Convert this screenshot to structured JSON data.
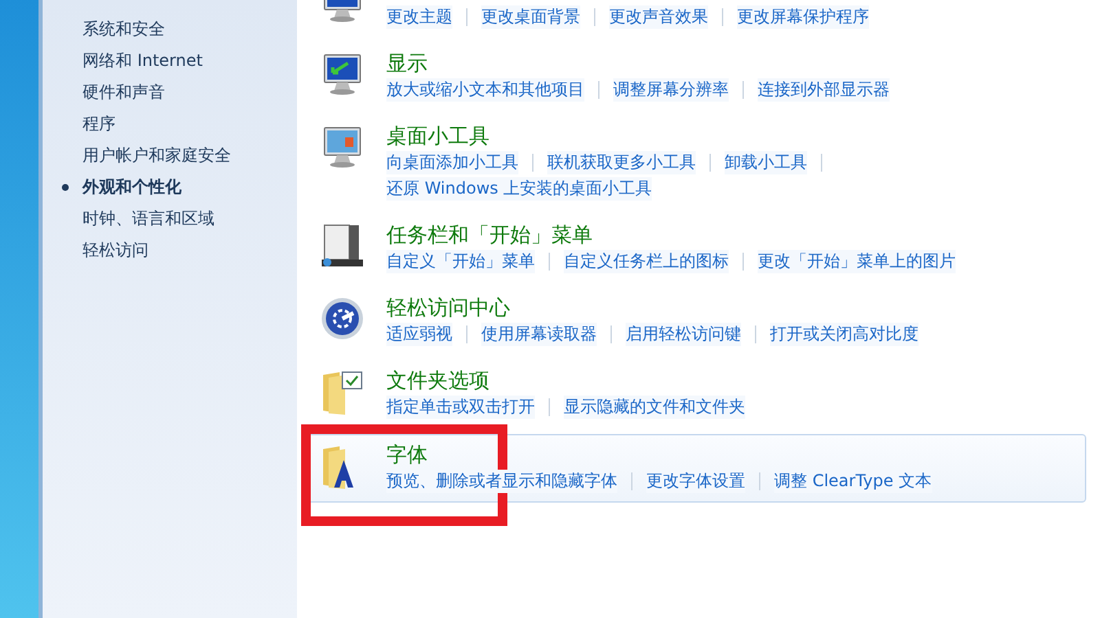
{
  "sidebar": {
    "items": [
      {
        "label": "系统和安全",
        "selected": false
      },
      {
        "label": "网络和 Internet",
        "selected": false
      },
      {
        "label": "硬件和声音",
        "selected": false
      },
      {
        "label": "程序",
        "selected": false
      },
      {
        "label": "用户帐户和家庭安全",
        "selected": false
      },
      {
        "label": "外观和个性化",
        "selected": true
      },
      {
        "label": "时钟、语言和区域",
        "selected": false
      },
      {
        "label": "轻松访问",
        "selected": false
      }
    ]
  },
  "categories": [
    {
      "kind": "monitor",
      "highlighted": false,
      "lines": [
        [
          "更改主题",
          "更改桌面背景",
          "更改声音效果",
          "更改屏幕保护程序"
        ]
      ]
    },
    {
      "kind": "display",
      "title": "显示",
      "highlighted": false,
      "lines": [
        [
          "放大或缩小文本和其他项目",
          "调整屏幕分辨率",
          "连接到外部显示器"
        ]
      ]
    },
    {
      "kind": "gadgets",
      "title": "桌面小工具",
      "highlighted": false,
      "lines": [
        [
          "向桌面添加小工具",
          "联机获取更多小工具",
          "卸载小工具"
        ],
        [
          "还原 Windows 上安装的桌面小工具"
        ]
      ]
    },
    {
      "kind": "taskbar",
      "title": "任务栏和「开始」菜单",
      "highlighted": false,
      "lines": [
        [
          "自定义「开始」菜单",
          "自定义任务栏上的图标",
          "更改「开始」菜单上的图片"
        ]
      ]
    },
    {
      "kind": "access",
      "title": "轻松访问中心",
      "highlighted": false,
      "lines": [
        [
          "适应弱视",
          "使用屏幕读取器",
          "启用轻松访问键",
          "打开或关闭高对比度"
        ]
      ]
    },
    {
      "kind": "folder",
      "title": "文件夹选项",
      "highlighted": false,
      "lines": [
        [
          "指定单击或双击打开",
          "显示隐藏的文件和文件夹"
        ]
      ]
    },
    {
      "kind": "fonts",
      "title": "字体",
      "highlighted": true,
      "annotated": true,
      "lines": [
        [
          "预览、删除或者显示和隐藏字体",
          "更改字体设置",
          "调整 ClearType 文本"
        ]
      ]
    }
  ]
}
